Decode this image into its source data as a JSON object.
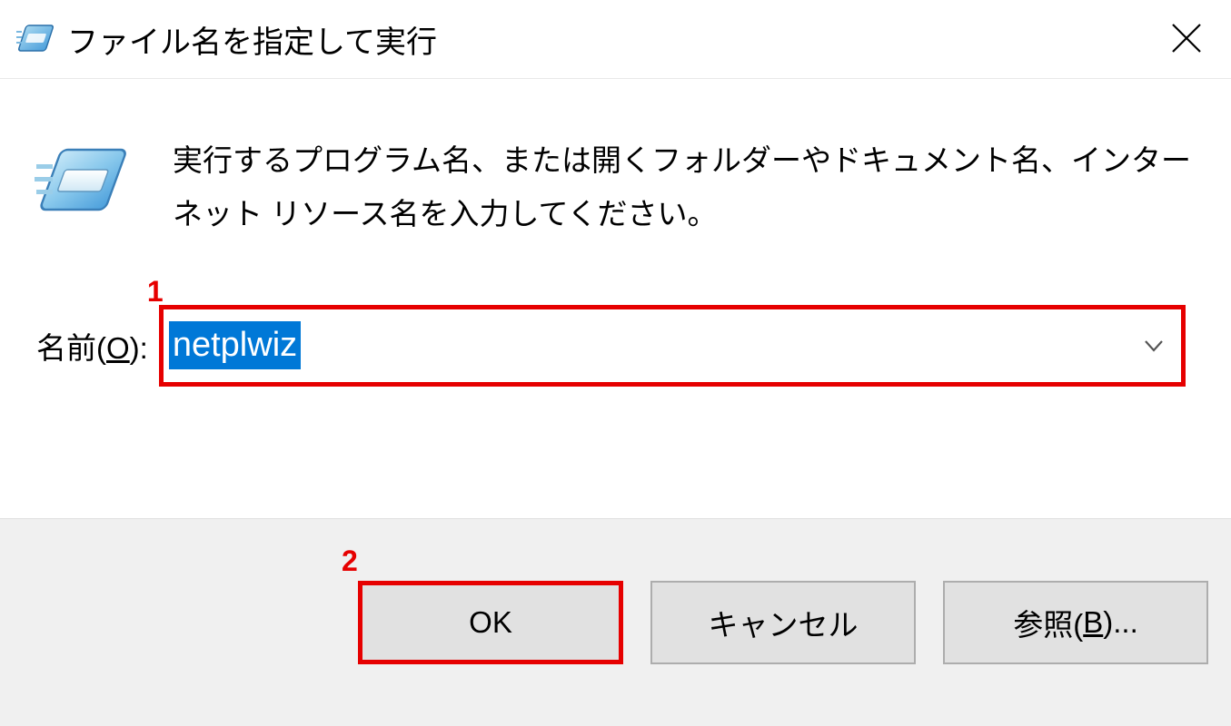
{
  "titlebar": {
    "title": "ファイル名を指定して実行"
  },
  "description": "実行するプログラム名、または開くフォルダーやドキュメント名、インターネット リソース名を入力してください。",
  "input": {
    "label_prefix": "名前(",
    "label_accesskey": "O",
    "label_suffix": "):",
    "value": "netplwiz"
  },
  "buttons": {
    "ok": "OK",
    "cancel": "キャンセル",
    "browse_prefix": "参照(",
    "browse_accesskey": "B",
    "browse_suffix": ")..."
  },
  "annotations": {
    "input": "1",
    "ok": "2"
  }
}
